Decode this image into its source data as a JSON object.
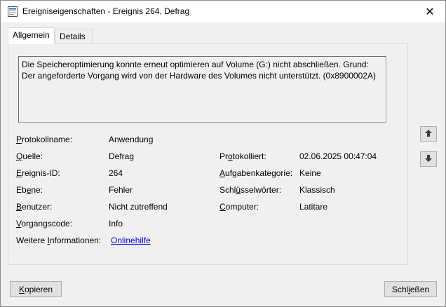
{
  "window": {
    "title": "Ereigniseigenschaften - Ereignis 264, Defrag",
    "close_glyph": "✕"
  },
  "tabs": [
    {
      "label": "Allgemein",
      "active": true
    },
    {
      "label": "Details",
      "active": false
    }
  ],
  "message": "Die Speicheroptimierung konnte erneut optimieren auf Volume (G:) nicht abschließen. Grund: Der angeforderte Vorgang wird von der Hardware des Volumes nicht unterstützt. (0x8900002A)",
  "fields": {
    "protokollname": {
      "label_u": "P",
      "label_rest": "rotokollname:",
      "value": "Anwendung"
    },
    "quelle": {
      "label_u": "Q",
      "label_rest": "uelle:",
      "value": "Defrag"
    },
    "ereignis_id": {
      "label_u": "E",
      "label_rest": "reignis-ID:",
      "value": "264"
    },
    "ebene": {
      "label_pre": "Eb",
      "label_u": "e",
      "label_rest": "ne:",
      "value": "Fehler"
    },
    "benutzer": {
      "label_u": "B",
      "label_rest": "enutzer:",
      "value": "Nicht zutreffend"
    },
    "vorgangscode": {
      "label_u": "V",
      "label_rest": "organgscode:",
      "value": "Info"
    },
    "weitere": {
      "label_pre": "Weitere ",
      "label_u": "I",
      "label_rest": "nformationen:",
      "value": "Onlinehilfe"
    },
    "protokolliert": {
      "label_pre": "Pr",
      "label_u": "o",
      "label_rest": "tokolliert:",
      "value": "02.06.2025 00:47:04"
    },
    "aufgabenkategorie": {
      "label_u": "A",
      "label_rest": "ufgabenkategorie:",
      "value": "Keine"
    },
    "schluesselwoerter": {
      "label_pre": "Schl",
      "label_u": "ü",
      "label_rest": "sselwörter:",
      "value": "Klassisch"
    },
    "computer": {
      "label_u": "C",
      "label_rest": "omputer:",
      "value": "Latitare"
    }
  },
  "buttons": {
    "kopieren": {
      "label_u": "K",
      "label_rest": "opieren"
    },
    "schliessen": {
      "label_pre": "Schl",
      "label_u": "i",
      "label_rest": "eßen"
    }
  },
  "icons": {
    "up": "arrow-up-icon",
    "down": "arrow-down-icon"
  },
  "colors": {
    "link": "#0000ee",
    "background": "#f0f0f0"
  }
}
